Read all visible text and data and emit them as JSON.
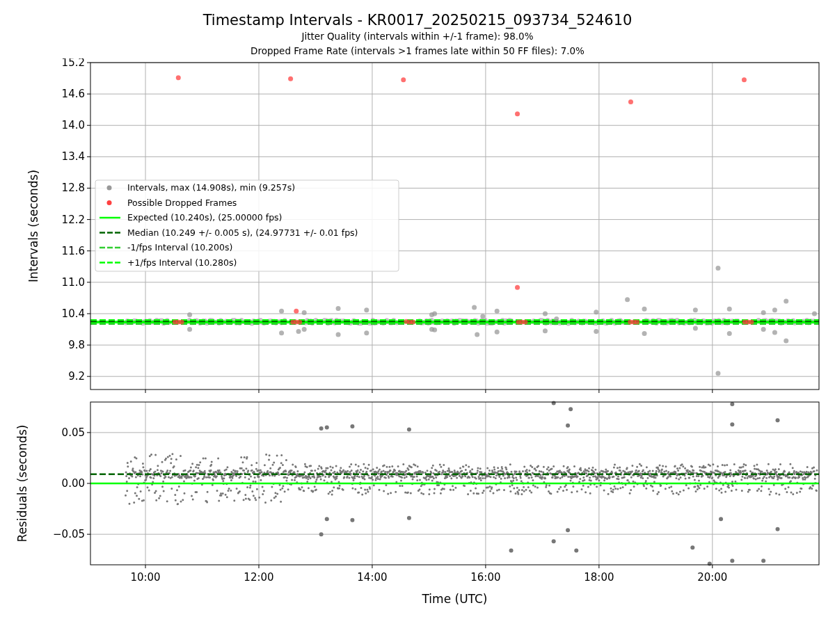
{
  "title": "Timestamp Intervals - KR0017_20250215_093734_524610",
  "subtitles": [
    "Jitter Quality (intervals within +/-1 frame): 98.0%",
    "Dropped Frame Rate (intervals >1 frames late within 50 FF files): 7.0%"
  ],
  "intervals_plot": {
    "chart_data": {
      "type": "scatter",
      "grid": true,
      "legend": true,
      "ylabel": "Intervals (seconds)",
      "xlim": [
        9.03,
        21.88
      ],
      "ylim": [
        8.95,
        15.2
      ],
      "yticks": [
        {
          "value": 9.2,
          "label": "9.2"
        },
        {
          "value": 9.8,
          "label": "9.8"
        },
        {
          "value": 10.4,
          "label": "10.4"
        },
        {
          "value": 11.0,
          "label": "11.0"
        },
        {
          "value": 11.6,
          "label": "11.6"
        },
        {
          "value": 12.2,
          "label": "12.2"
        },
        {
          "value": 12.8,
          "label": "12.8"
        },
        {
          "value": 13.4,
          "label": "13.4"
        },
        {
          "value": 14.0,
          "label": "14.0"
        },
        {
          "value": 14.6,
          "label": "14.6"
        },
        {
          "value": 15.2,
          "label": "15.2"
        }
      ],
      "series": [
        {
          "name": "Intervals, max (14.908s), min (9.257s)",
          "type": "scatter",
          "color": "#999999",
          "x": [
            10.78,
            10.78,
            12.4,
            12.4,
            12.7,
            12.8,
            12.8,
            13.4,
            13.4,
            13.9,
            13.9,
            15.05,
            15.05,
            15.1,
            15.1,
            15.8,
            15.85,
            15.95,
            16.2,
            16.2,
            17.05,
            17.05,
            17.25,
            17.95,
            17.95,
            18.5,
            18.8,
            18.8,
            19.7,
            19.7,
            20.1,
            20.1,
            20.3,
            20.3,
            20.9,
            20.9,
            21.1,
            21.1,
            21.3,
            21.3,
            21.8
          ],
          "values": [
            10.38,
            10.1,
            10.45,
            10.03,
            10.06,
            10.42,
            10.1,
            10.5,
            10.0,
            10.47,
            10.03,
            10.38,
            10.1,
            10.4,
            10.09,
            10.52,
            10.0,
            10.35,
            10.45,
            10.05,
            10.4,
            10.07,
            10.3,
            10.43,
            10.06,
            10.67,
            10.49,
            10.02,
            10.47,
            10.12,
            11.27,
            9.26,
            10.49,
            10.02,
            10.42,
            10.1,
            10.47,
            10.04,
            10.64,
            9.88,
            10.4
          ]
        },
        {
          "name": "Possible Dropped Frames",
          "type": "scatter",
          "color": "#ff4040",
          "x": [
            10.58,
            12.56,
            14.55,
            16.56,
            18.56,
            20.56,
            12.66,
            16.56,
            10.52,
            10.58,
            10.64,
            12.6,
            12.66,
            12.72,
            14.6,
            14.66,
            14.72,
            16.58,
            16.64,
            16.7,
            18.55,
            18.61,
            18.67,
            20.57,
            20.63,
            20.69
          ],
          "values": [
            14.91,
            14.89,
            14.87,
            14.22,
            14.45,
            14.87,
            10.45,
            10.9,
            10.24,
            10.24,
            10.24,
            10.24,
            10.24,
            10.24,
            10.25,
            10.24,
            10.24,
            10.24,
            10.24,
            10.24,
            10.24,
            10.24,
            10.24,
            10.24,
            10.24,
            10.24
          ]
        },
        {
          "name": "Expected (10.240s), (25.00000 fps)",
          "type": "line",
          "line_style": "solid",
          "color": "#00ff00",
          "x": [
            9.03,
            21.88
          ],
          "values": [
            10.24,
            10.24
          ]
        },
        {
          "name": "Median (10.249 +/- 0.005 s), (24.97731 +/- 0.01 fps)",
          "type": "line",
          "line_style": "dashed",
          "color": "#006400",
          "x": [
            9.03,
            21.88
          ],
          "values": [
            10.25,
            10.25
          ]
        },
        {
          "name": "-1/fps Interval (10.200s)",
          "type": "line",
          "line_style": "dashed",
          "color": "#32cd32",
          "x": [
            9.03,
            21.88
          ],
          "values": [
            10.2,
            10.2
          ]
        },
        {
          "name": "+1/fps Interval (10.280s)",
          "type": "line",
          "line_style": "dashed",
          "color": "#00ff00",
          "x": [
            9.03,
            21.88
          ],
          "values": [
            10.28,
            10.28
          ]
        }
      ]
    }
  },
  "residuals_plot": {
    "chart_data": {
      "type": "scatter",
      "grid": true,
      "xlabel": "Time (UTC)",
      "ylabel": "Residuals (seconds)",
      "xlim": [
        9.03,
        21.88
      ],
      "ylim": [
        -0.08,
        0.08
      ],
      "xticks": [
        {
          "value": 10,
          "label": "10:00"
        },
        {
          "value": 12,
          "label": "12:00"
        },
        {
          "value": 14,
          "label": "14:00"
        },
        {
          "value": 16,
          "label": "16:00"
        },
        {
          "value": 18,
          "label": "18:00"
        },
        {
          "value": 20,
          "label": "20:00"
        }
      ],
      "yticks": [
        {
          "value": -0.05,
          "label": "−0.05"
        },
        {
          "value": 0,
          "label": "0.00"
        },
        {
          "value": 0.05,
          "label": "0.05"
        }
      ],
      "series": [
        {
          "type": "scatter",
          "color": "#777777",
          "x": [
            13.1,
            13.2,
            13.65,
            14.65,
            17.2,
            17.45,
            17.5,
            20.35,
            20.35,
            21.15,
            13.1,
            13.2,
            13.65,
            14.65,
            16.45,
            17.2,
            17.45,
            17.6,
            19.65,
            19.95,
            20.15,
            20.35,
            20.9,
            21.15
          ],
          "values": [
            0.054,
            0.055,
            0.056,
            0.053,
            0.079,
            0.057,
            0.073,
            0.078,
            0.058,
            0.062,
            -0.05,
            -0.035,
            -0.036,
            -0.034,
            -0.066,
            -0.057,
            -0.046,
            -0.066,
            -0.063,
            -0.079,
            -0.035,
            -0.076,
            -0.076,
            -0.045
          ]
        },
        {
          "type": "line",
          "line_style": "solid",
          "color": "#00ff00",
          "x": [
            9.03,
            21.88
          ],
          "values": [
            0,
            0
          ]
        },
        {
          "type": "line",
          "line_style": "dashed",
          "color": "#006400",
          "x": [
            9.03,
            21.88
          ],
          "values": [
            0.009,
            0.009
          ]
        }
      ]
    }
  }
}
